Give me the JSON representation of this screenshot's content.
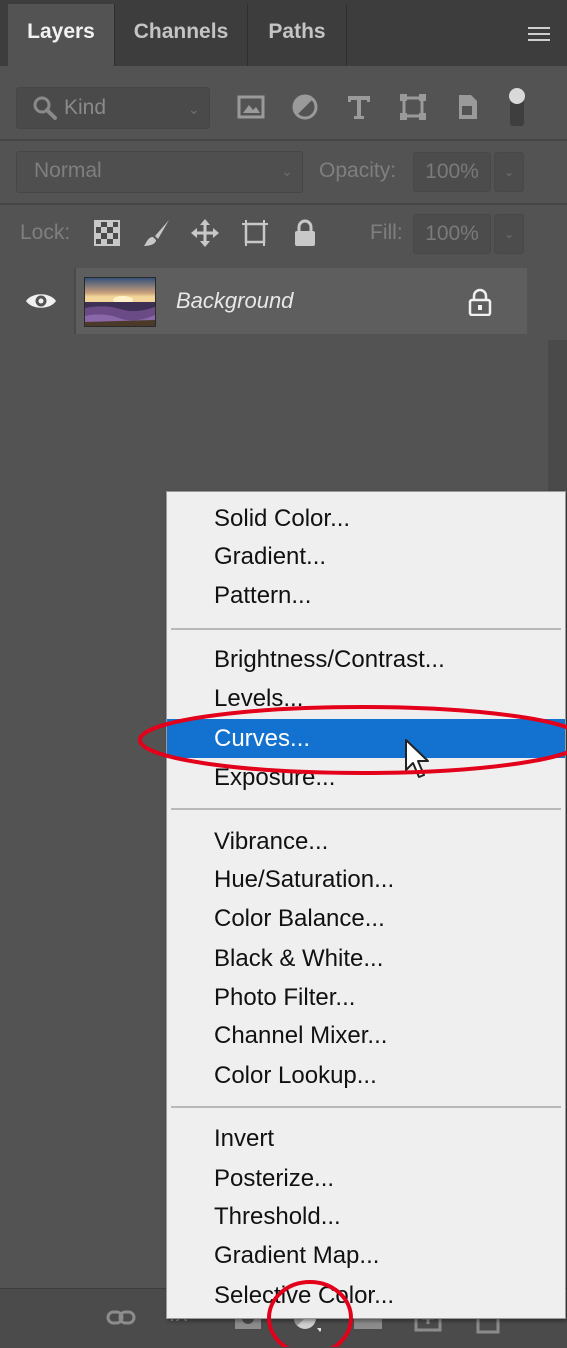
{
  "tabs": [
    {
      "label": "Layers",
      "active": true
    },
    {
      "label": "Channels",
      "active": false
    },
    {
      "label": "Paths",
      "active": false
    }
  ],
  "filter": {
    "label": "Kind"
  },
  "blend": {
    "mode": "Normal",
    "opacity_label": "Opacity:",
    "opacity_value": "100%"
  },
  "lock": {
    "label": "Lock:",
    "fill_label": "Fill:",
    "fill_value": "100%"
  },
  "layer": {
    "name": "Background",
    "locked": true,
    "visible": true
  },
  "menu": {
    "groups": [
      [
        "Solid Color...",
        "Gradient...",
        "Pattern..."
      ],
      [
        "Brightness/Contrast...",
        "Levels...",
        "Curves...",
        "Exposure..."
      ],
      [
        "Vibrance...",
        "Hue/Saturation...",
        "Color Balance...",
        "Black & White...",
        "Photo Filter...",
        "Channel Mixer...",
        "Color Lookup..."
      ],
      [
        "Invert",
        "Posterize...",
        "Threshold...",
        "Gradient Map...",
        "Selective Color..."
      ]
    ],
    "selected": "Curves..."
  },
  "colors": {
    "panel": "#535353",
    "menu_bg": "#efefef",
    "highlight": "#1372d0",
    "annotation": "#e3001b"
  },
  "icons": [
    "search-icon",
    "image-filter-icon",
    "adjustment-filter-icon",
    "type-filter-icon",
    "shape-filter-icon",
    "smart-object-filter-icon",
    "filter-toggle-icon",
    "lock-transparent-icon",
    "lock-paint-icon",
    "lock-position-icon",
    "lock-artboard-icon",
    "lock-all-icon",
    "eye-icon",
    "link-icon",
    "fx-icon",
    "mask-icon",
    "adjustment-layer-icon",
    "group-icon",
    "new-layer-icon",
    "trash-icon"
  ]
}
